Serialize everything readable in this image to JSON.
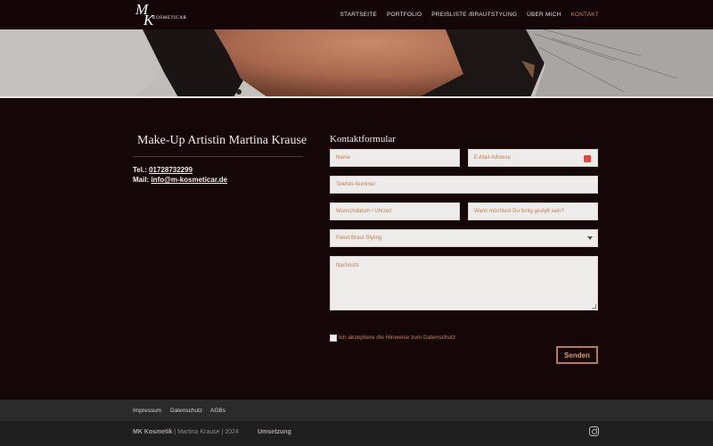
{
  "header": {
    "logo": {
      "m": "M",
      "k": "K",
      "text": "KOSMETICAR"
    },
    "nav": [
      "STARTSEITE",
      "PORTFOLIO",
      "PREISLISTE /BRAUTSTYLING",
      "ÜBER MICH",
      "KONTAKT"
    ],
    "active_nav": "KONTAKT"
  },
  "artist": {
    "name": "Make-Up Artistin Martina Krause",
    "phone_label": "Tel.: ",
    "phone": "01728732299",
    "mail_label": "Mail: ",
    "mail": "info@m-kosmeticar.de"
  },
  "form": {
    "title": "Kontaktformular",
    "name_placeholder": "Name",
    "email_placeholder": "E-Mail-Adresse",
    "phone_placeholder": "Telefon-Nummer",
    "date_placeholder": "Wunschdatum / Uhrzeit",
    "ready_placeholder": "Wann möchtest Du fertig gestylt sein?",
    "package_selected": "Paket Braut-Styling",
    "message_placeholder": "Nachricht",
    "consent": "Ich akzeptiere die Hinweise zum Datenschutz",
    "submit": "Senden"
  },
  "footer": {
    "links": [
      "Impressum",
      "Datenschutz",
      "AGBs"
    ],
    "brand": "MK Kosmetik",
    "separator": " | ",
    "owner": "Martina Krause | 2024",
    "umsetzung": "Umsetzung",
    "social_icon": "instagram-icon"
  },
  "colors": {
    "background": "#150608",
    "accent": "#c8845a",
    "footer": "#2b2b2b"
  }
}
